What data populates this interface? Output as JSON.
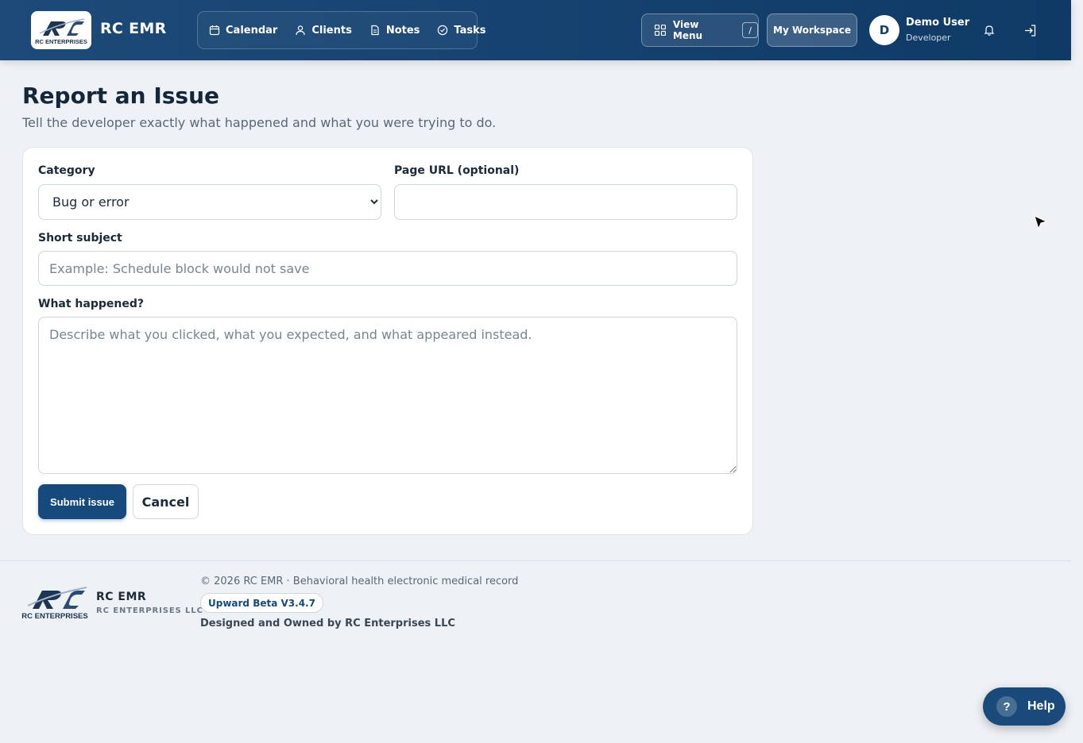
{
  "header": {
    "brand": "RC EMR",
    "logo_text": "RC ENTERPRISES",
    "nav": [
      {
        "label": "Calendar",
        "icon": "calendar-icon"
      },
      {
        "label": "Clients",
        "icon": "user-icon"
      },
      {
        "label": "Notes",
        "icon": "document-icon"
      },
      {
        "label": "Tasks",
        "icon": "check-circle-icon"
      }
    ],
    "view_menu_label": "View Menu",
    "view_menu_shortcut": "/",
    "workspace_label": "My Workspace",
    "user": {
      "initial": "D",
      "name": "Demo User",
      "role": "Developer"
    }
  },
  "page": {
    "title": "Report an Issue",
    "subtitle": "Tell the developer exactly what happened and what you were trying to do."
  },
  "form": {
    "category_label": "Category",
    "category_value": "Bug or error",
    "page_url_label": "Page URL (optional)",
    "page_url_value": "",
    "subject_label": "Short subject",
    "subject_placeholder": "Example: Schedule block would not save",
    "details_label": "What happened?",
    "details_placeholder": "Describe what you clicked, what you expected, and what appeared instead.",
    "submit_label": "Submit issue",
    "cancel_label": "Cancel"
  },
  "footer": {
    "brand": "RC EMR",
    "company": "RC ENTERPRISES LLC",
    "logo_text": "RC ENTERPRISES",
    "copyright": "© 2026 RC EMR · Behavioral health electronic medical record",
    "version": "Upward Beta V3.4.7",
    "owned": "Designed and Owned by RC Enterprises LLC"
  },
  "help": {
    "label": "Help",
    "glyph": "?"
  },
  "colors": {
    "header": "#164271",
    "primary": "#164a7c",
    "background": "#eef1f5"
  }
}
